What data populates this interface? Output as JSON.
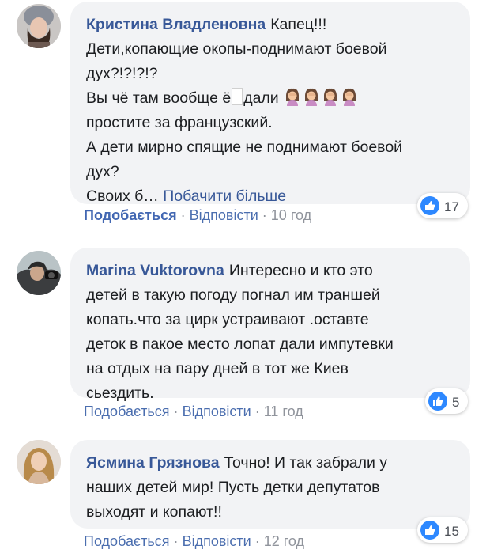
{
  "comments": [
    {
      "author": "Кристина Владленовна",
      "avatar": "woman-avatar",
      "lines": [
        "Капец!!!",
        "Дети,копающие окопы-поднимают боевой",
        "дух?!?!?!?",
        "Вы чё там вообще ё",
        "дали",
        "простите за французский.",
        "А дети мирно спящие не поднимают боевой",
        "дух?",
        "Своих б…"
      ],
      "see_more": "Побачити більше",
      "like_label": "Подобається",
      "reply_label": "Відповісти",
      "time": "10 год",
      "reactions": "17",
      "emoji": "facepalm-woman-emoji"
    },
    {
      "author": "Marina Vuktorovna",
      "avatar": "woman-avatar",
      "lines": [
        "Интересно и кто это",
        "детей в такую погоду погнал им траншей",
        "копать.что за цирк устраивают .оставте",
        "деток в пакое место лопат дали импутевки",
        "на отдых на пару дней в тот же Киев",
        "сьездить."
      ],
      "like_label": "Подобається",
      "reply_label": "Відповісти",
      "time": "11 год",
      "reactions": "5"
    },
    {
      "author": "Ясмина Грязнова",
      "avatar": "woman-avatar",
      "lines": [
        "Точно! И так забрали у",
        "наших детей мир! Пусть детки депутатов",
        "выходят и копают!!"
      ],
      "like_label": "Подобається",
      "reply_label": "Відповісти",
      "time": "12 год",
      "reactions": "15"
    }
  ],
  "separator": "·",
  "colors": {
    "bubble": "#f2f3f5",
    "author": "#385898",
    "meta": "#90949c",
    "like_badge": "#2d88ff"
  }
}
